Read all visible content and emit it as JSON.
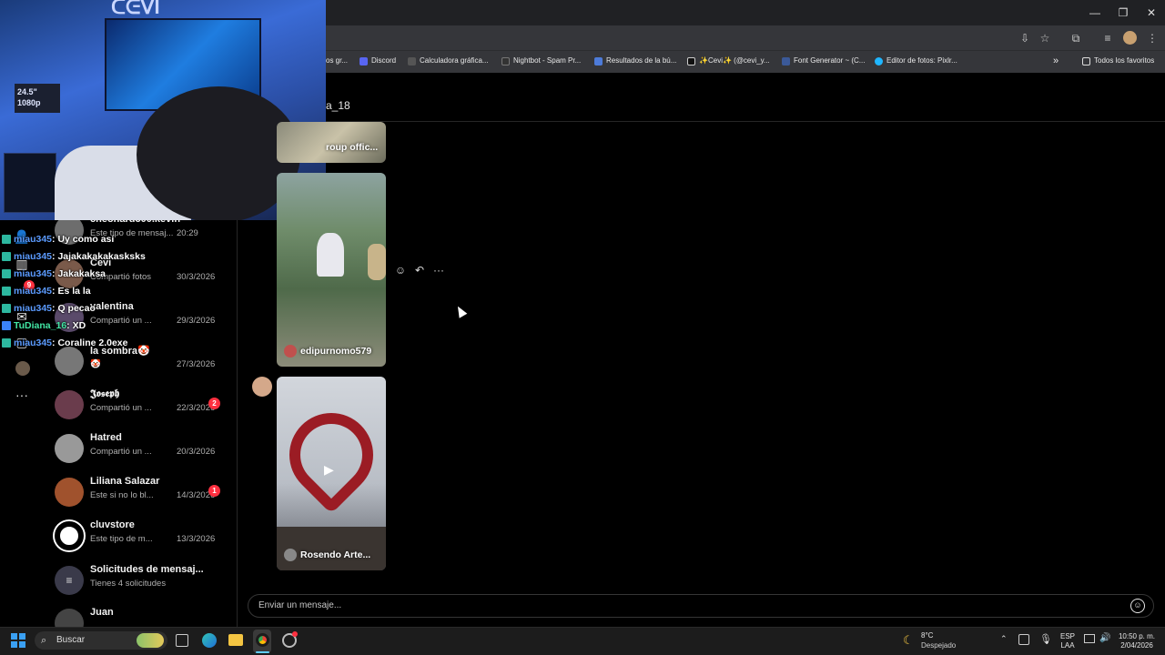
{
  "browser": {
    "bookmarks": [
      {
        "label": "os gr...",
        "color": "#888888"
      },
      {
        "label": "Discord",
        "color": "#5865f2"
      },
      {
        "label": "Calculadora gráfica...",
        "color": "#555555"
      },
      {
        "label": "Nightbot - Spam Pr...",
        "color": "#333333"
      },
      {
        "label": "Resultados de la bú...",
        "color": "#4d7bd9"
      },
      {
        "label": "✨Cevi✨ (@cevi_y...",
        "color": "#111111"
      },
      {
        "label": "Font Generator ~ (C...",
        "color": "#3b5998"
      },
      {
        "label": "Editor de fotos: Pixlr...",
        "color": "#1fb6ff"
      }
    ],
    "all_favorites": "Todos los favoritos"
  },
  "dm_header": {
    "title": "a_18"
  },
  "conversations": [
    {
      "name": "cheonard300.kevin",
      "preview": "Este tipo de mensaj...",
      "time": "20:29",
      "badge": "",
      "avatar_color": "#6d6d6d"
    },
    {
      "name": "Cevi",
      "preview": "Compartió fotos",
      "time": "30/3/2026",
      "badge": "",
      "avatar_color": "#7a5a4a"
    },
    {
      "name": "valentina",
      "preview": "Compartió un ...",
      "time": "29/3/2026",
      "badge": "",
      "avatar_color": "#5a4a6a"
    },
    {
      "name": "la sombra🤡",
      "preview": "🤡",
      "time": "27/3/2026",
      "badge": "",
      "avatar_color": "#777777"
    },
    {
      "name": "𝕵𝖔𝖘𝖊𝖕𝖍",
      "preview": "Compartió un ...",
      "time": "22/3/2026",
      "badge": "2",
      "avatar_color": "#6a3c4c"
    },
    {
      "name": "Hatred",
      "preview": "Compartió un ...",
      "time": "20/3/2026",
      "badge": "",
      "avatar_color": "#999999"
    },
    {
      "name": "Liliana Salazar",
      "preview": "Este si no lo bl...",
      "time": "14/3/2026",
      "badge": "1",
      "avatar_color": "#a0522d"
    },
    {
      "name": "cluvstore",
      "preview": "Este tipo de m...",
      "time": "13/3/2026",
      "badge": "",
      "avatar_color": "#ffffff"
    },
    {
      "name": "Solicitudes de mensaj...",
      "preview": "Tienes 4 solicitudes",
      "time": "",
      "badge": "",
      "avatar_color": "#3a3a4a"
    },
    {
      "name": "Juan",
      "preview": "",
      "time": "",
      "badge": "",
      "avatar_color": "#444444"
    }
  ],
  "rail": {
    "notification_count": "9"
  },
  "stream_chat": [
    {
      "user": "miau345",
      "message": ": Uy como así"
    },
    {
      "user": "miau345",
      "message": ": Jajakakakakasksks"
    },
    {
      "user": "miau345",
      "message": ": Jakakaksa"
    },
    {
      "user": "miau345",
      "message": ": Es la la"
    },
    {
      "user": "miau345",
      "message": ": Q pecao"
    },
    {
      "user": "TuDiana_16",
      "message": ": XD"
    },
    {
      "user": "miau345",
      "message": ": Coraline 2.0exe"
    }
  ],
  "webcam": {
    "monitor_label": "24.5\" 1080p"
  },
  "shared_media": [
    {
      "label": "roup offic..."
    },
    {
      "label": "edipurnomo579"
    },
    {
      "label": "Rosendo Arte..."
    }
  ],
  "composer": {
    "placeholder": "Enviar un mensaje..."
  },
  "taskbar": {
    "search_label": "Buscar",
    "weather_temp": "8°C",
    "weather_desc": "Despejado",
    "lang_top": "ESP",
    "lang_bottom": "LAA",
    "time": "10:50 p. m.",
    "date": "2/04/2026"
  }
}
